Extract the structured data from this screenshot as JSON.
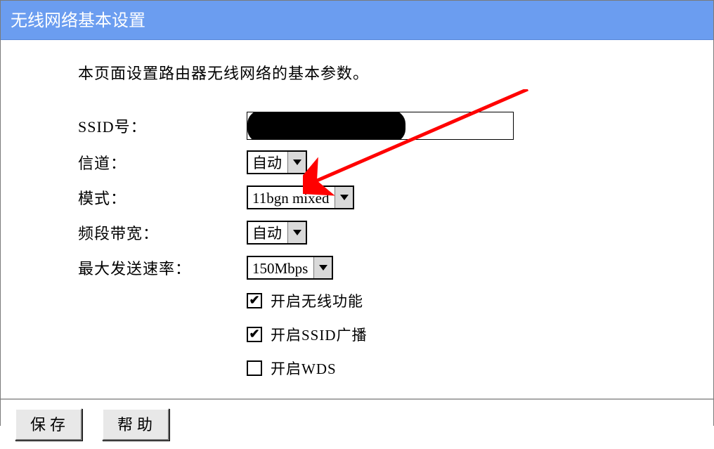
{
  "title": "无线网络基本设置",
  "intro": "本页面设置路由器无线网络的基本参数。",
  "labels": {
    "ssid": "SSID号：",
    "channel": "信道：",
    "mode": "模式：",
    "bandwidth": "频段带宽：",
    "maxrate": "最大发送速率："
  },
  "fields": {
    "ssid_value": "",
    "channel_value": "自动",
    "mode_value": "11bgn mixed",
    "bandwidth_value": "自动",
    "maxrate_value": "150Mbps"
  },
  "checkboxes": {
    "enable_wireless": {
      "label": "开启无线功能",
      "checked": true
    },
    "enable_ssid_broadcast": {
      "label": "开启SSID广播",
      "checked": true
    },
    "enable_wds": {
      "label": "开启WDS",
      "checked": false
    }
  },
  "buttons": {
    "save": "保存",
    "help": "帮助"
  },
  "annotation": {
    "arrow_color": "#ff0000"
  }
}
